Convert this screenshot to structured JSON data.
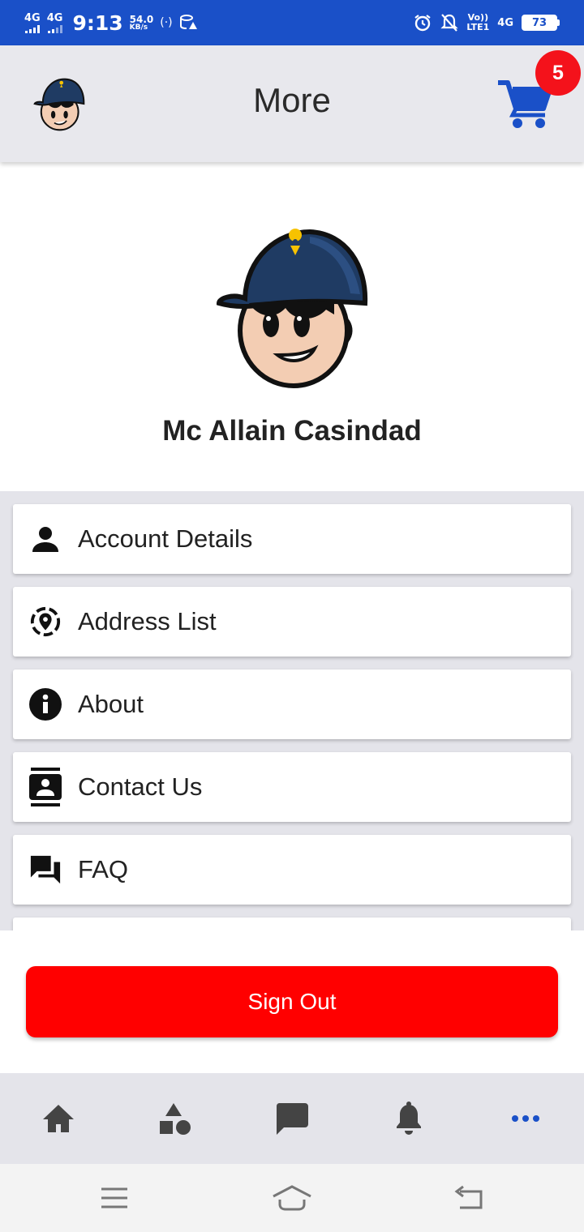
{
  "status_bar": {
    "network1": "4G",
    "network2": "4G",
    "time": "9:13",
    "speed_value": "54.0",
    "speed_unit": "KB/s",
    "volte": "Vo))",
    "lte": "LTE1",
    "network3": "4G",
    "battery": "73"
  },
  "header": {
    "title": "More",
    "cart_count": "5",
    "accent_color": "#1a50c8"
  },
  "profile": {
    "name": "Mc Allain Casindad"
  },
  "menu": {
    "items": [
      {
        "label": "Account Details",
        "icon": "person-icon"
      },
      {
        "label": "Address List",
        "icon": "location-icon"
      },
      {
        "label": "About",
        "icon": "info-icon"
      },
      {
        "label": "Contact Us",
        "icon": "contact-card-icon"
      },
      {
        "label": "FAQ",
        "icon": "chat-bubbles-icon"
      }
    ]
  },
  "sign_out": {
    "label": "Sign Out",
    "color": "#ff0000"
  },
  "bottom_nav": {
    "items": [
      "home-icon",
      "categories-icon",
      "messages-icon",
      "notifications-icon",
      "more-icon"
    ],
    "active": "more-icon",
    "active_color": "#1a50c8"
  },
  "system_nav": {
    "items": [
      "menu-icon",
      "home-icon",
      "back-icon"
    ]
  }
}
